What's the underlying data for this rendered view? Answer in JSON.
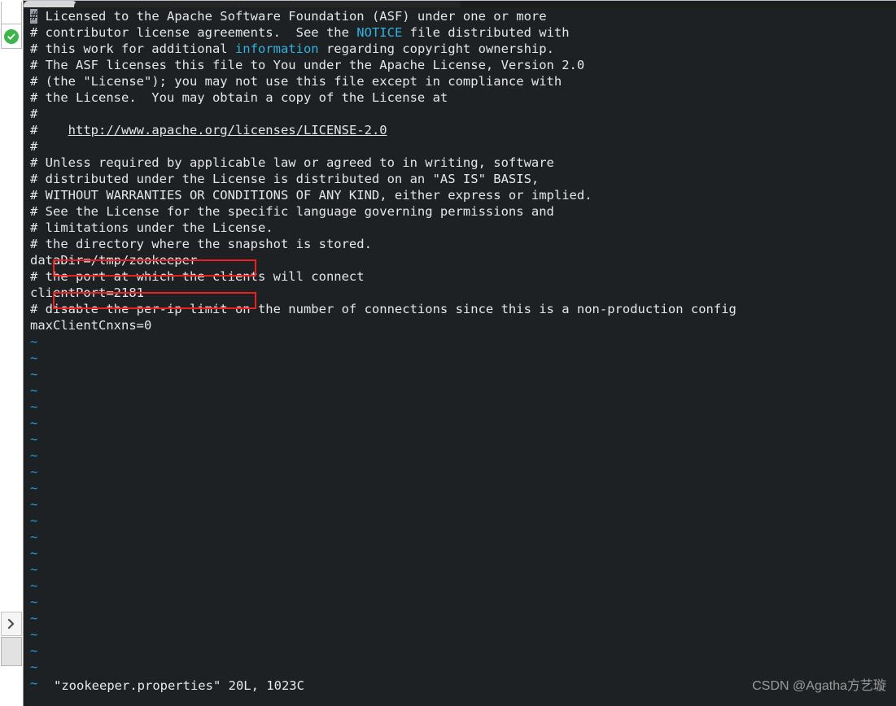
{
  "window": {
    "tab_bar": {
      "inactive_tab_label": "",
      "active_tab_label": ""
    }
  },
  "sidebar": {
    "status_icon": "green-check-icon",
    "expand_icon": "chevron-right-icon",
    "items": [
      {
        "name": "status-ok",
        "label": ""
      },
      {
        "name": "expand-panel",
        "label": ""
      }
    ]
  },
  "terminal": {
    "editor": "vim",
    "colors": {
      "background": "#1e2124",
      "foreground": "#e6e6e6",
      "keyword": "#2fb3e0",
      "tilde": "#1b9fe0",
      "annotation": "#f01f1f"
    },
    "lines": [
      {
        "type": "comment",
        "text": "# Licensed to the Apache Software Foundation (ASF) under one or more",
        "cursor_at": 0
      },
      {
        "type": "comment",
        "text": "# contributor license agreements.  See the ",
        "hl": "NOTICE",
        "tail": " file distributed with"
      },
      {
        "type": "comment",
        "text": "# this work for additional ",
        "hl": "information",
        "tail": " regarding copyright ownership."
      },
      {
        "type": "comment",
        "text": "# The ASF licenses this file to You under the Apache License, Version 2.0"
      },
      {
        "type": "comment",
        "text": "# (the \"License\"); you may not use this file except in compliance with"
      },
      {
        "type": "comment",
        "text": "# the License.  You may obtain a copy of the License at"
      },
      {
        "type": "comment",
        "text": "#"
      },
      {
        "type": "link",
        "prefix": "#    ",
        "text": "http://www.apache.org/licenses/LICENSE-2.0"
      },
      {
        "type": "comment",
        "text": "#"
      },
      {
        "type": "comment",
        "text": "# Unless required by applicable law or agreed to in writing, software"
      },
      {
        "type": "comment",
        "text": "# distributed under the License is distributed on an \"AS IS\" BASIS,"
      },
      {
        "type": "comment",
        "text": "# WITHOUT WARRANTIES OR CONDITIONS OF ANY KIND, either express or implied."
      },
      {
        "type": "comment",
        "text": "# See the License for the specific language governing permissions and"
      },
      {
        "type": "comment",
        "text": "# limitations under the License."
      },
      {
        "type": "comment",
        "text": "# the directory where the snapshot is stored."
      },
      {
        "type": "setting",
        "text": "dataDir=/tmp/zookeeper",
        "annotated": true
      },
      {
        "type": "comment",
        "text": "# the port at which the clients will connect"
      },
      {
        "type": "setting",
        "text": "clientPort=2181",
        "annotated": true
      },
      {
        "type": "comment",
        "text": "# disable the per-ip limit on the number of connections since this is a non-production config"
      },
      {
        "type": "setting",
        "text": "maxClientCnxns=0"
      }
    ],
    "empty_line_marker": "~",
    "empty_line_count": 22,
    "status_line": "\"zookeeper.properties\" 20L, 1023C",
    "annotations": [
      {
        "name": "datadir-highlight",
        "target": "dataDir=/tmp/zookeeper"
      },
      {
        "name": "clientport-highlight",
        "target": "clientPort=2181"
      }
    ]
  },
  "watermark": {
    "text": "CSDN @Agatha方艺璇"
  }
}
